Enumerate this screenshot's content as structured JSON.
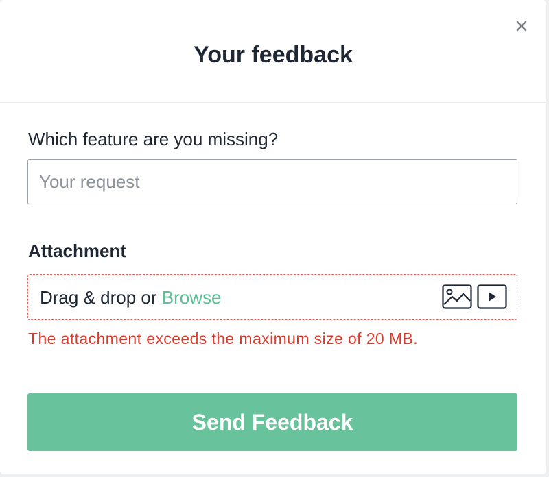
{
  "modal": {
    "title": "Your feedback",
    "close_icon": "close-icon"
  },
  "form": {
    "question_label": "Which feature are you missing?",
    "request_input": {
      "value": "",
      "placeholder": "Your request"
    },
    "attachment_label": "Attachment",
    "dropzone": {
      "text": "Drag & drop or ",
      "browse_label": "Browse",
      "icons": [
        "image-icon",
        "video-icon"
      ]
    },
    "error_message": "The attachment exceeds the maximum size of 20 MB.",
    "submit_label": "Send Feedback"
  },
  "colors": {
    "accent": "#68c29b",
    "link": "#5cbf95",
    "error": "#dc3a2c",
    "text": "#1e2733"
  }
}
